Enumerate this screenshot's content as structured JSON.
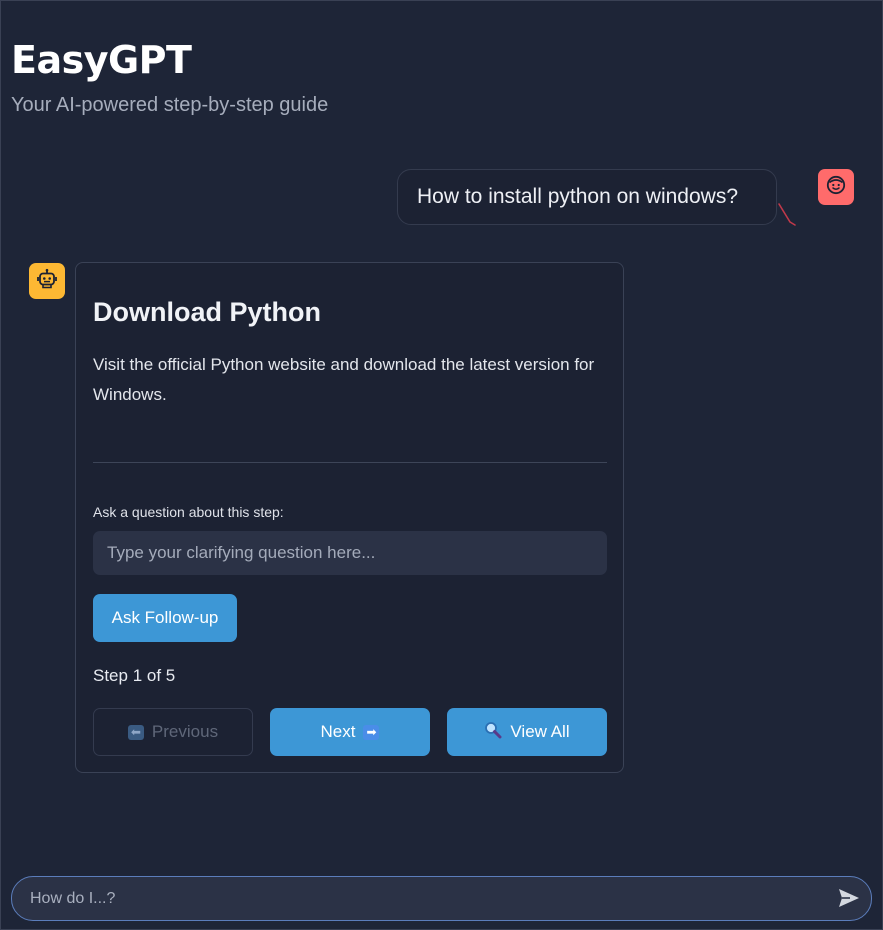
{
  "app": {
    "title": "EasyGPT",
    "subtitle": "Your AI-powered step-by-step guide"
  },
  "conversation": {
    "user_message": "How to install python on windows?",
    "user_avatar_icon": "smiling-face-icon",
    "bot_avatar_icon": "robot-face-icon"
  },
  "step_card": {
    "title": "Download Python",
    "description": "Visit the official Python website and download the latest version for Windows.",
    "question_label": "Ask a question about this step:",
    "question_placeholder": "Type your clarifying question here...",
    "followup_label": "Ask Follow-up",
    "step_counter": "Step 1 of 5",
    "current_step": 1,
    "total_steps": 5,
    "prev_label": "Previous",
    "next_label": "Next",
    "view_all_label": "View All",
    "prev_icon": "left-arrow-icon",
    "next_icon": "right-arrow-icon",
    "view_all_icon": "magnifying-glass-icon"
  },
  "chat_input": {
    "placeholder": "How do I...?",
    "send_icon": "send-icon"
  },
  "colors": {
    "background": "#1e2537",
    "accent": "#3d97d6",
    "user_avatar": "#ff6b6b",
    "bot_avatar": "#fdb833"
  }
}
